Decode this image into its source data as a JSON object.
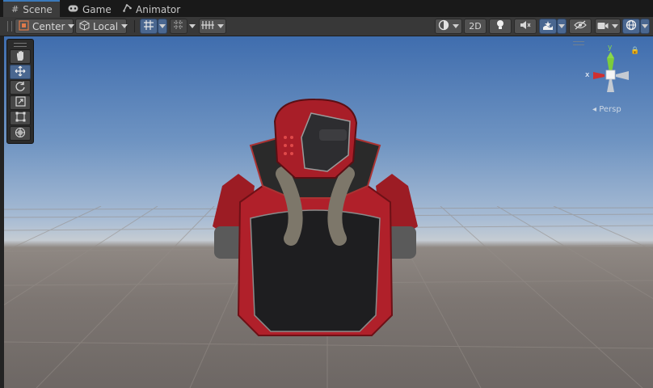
{
  "tabs": [
    {
      "label": "Scene",
      "icon": "grid-icon",
      "active": true
    },
    {
      "label": "Game",
      "icon": "gamepad-icon",
      "active": false
    },
    {
      "label": "Animator",
      "icon": "animator-icon",
      "active": false
    }
  ],
  "toolbar": {
    "pivot_label": "Center",
    "space_label": "Local",
    "mode_2d_label": "2D"
  },
  "gizmo": {
    "x_label": "x",
    "y_label": "y",
    "projection_label": "Persp"
  },
  "colors": {
    "accent": "#4a6790",
    "tab_highlight": "#3a79bb",
    "axis_x": "#d03030",
    "axis_y": "#7ccc3c",
    "armor_red": "#b0202a"
  }
}
